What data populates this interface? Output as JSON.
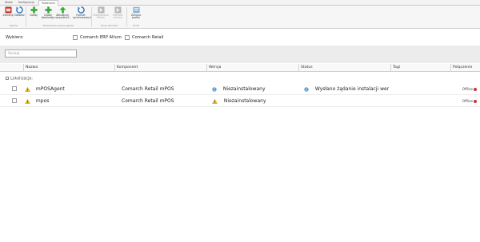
{
  "tabs": [
    "Widok",
    "Konfiguracja",
    "Pobieranie"
  ],
  "ribbon": {
    "buttons": [
      {
        "label": "Zamknij",
        "icon": "close-app-icon"
      },
      {
        "label": "Odśwież",
        "icon": "refresh-icon"
      },
      {
        "label": "Dodaj",
        "icon": "add-icon"
      },
      {
        "label": "Dodaj lokalizację",
        "icon": "add-location-icon"
      },
      {
        "label": "Aktualizuj wszystkich",
        "icon": "update-all-icon"
      },
      {
        "label": "Format synchronizacji",
        "icon": "sync-format-icon"
      },
      {
        "label": "Odświeżanie filtrów",
        "icon": "filter-refresh-icon"
      },
      {
        "label": "Odwołaj zmiany",
        "icon": "revert-icon"
      },
      {
        "label": "Zmiana profilu",
        "icon": "profile-icon"
      }
    ],
    "groups": [
      "Ogólne",
      "Zarządzanie akcją agenta",
      "Akcje wdrożeń",
      "Profil"
    ]
  },
  "choose": {
    "label": "Wybierz:",
    "options": [
      "Comarch ERP Altum",
      "Comarch Retail"
    ]
  },
  "search": {
    "placeholder": "Szukaj"
  },
  "table": {
    "headers": [
      "Nazwa",
      "Komponent",
      "Wersja",
      "Status",
      "Tagi",
      "Połączenie"
    ],
    "group": "Lokalizacja:",
    "rows": [
      {
        "name": "mPOSAgent",
        "component": "Comarch Retail mPOS",
        "version": "Niezainstalowany",
        "status": "Wysłano żądanie instalacji wer",
        "connection": "Offline"
      },
      {
        "name": "mpos",
        "component": "Comarch Retail mPOS",
        "version": "Niezainstalowany",
        "status": "",
        "connection": "Offline"
      }
    ]
  }
}
